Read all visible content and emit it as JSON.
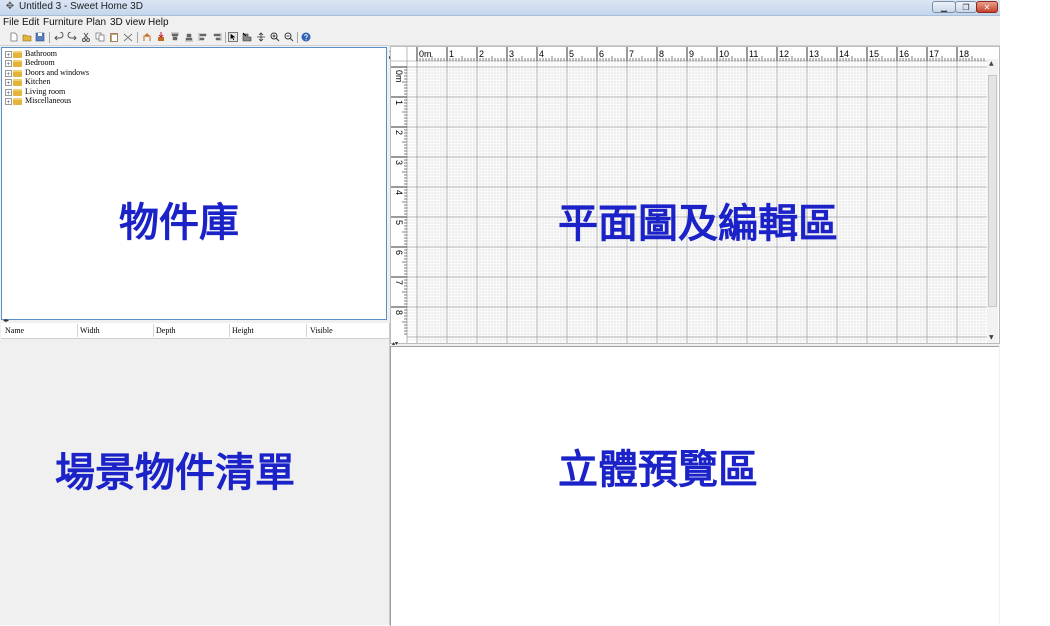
{
  "window": {
    "title": "Untitled 3 - Sweet Home 3D"
  },
  "menu": [
    "File",
    "Edit",
    "Furniture",
    "Plan",
    "3D view",
    "Help"
  ],
  "catalog": {
    "categories": [
      "Bathroom",
      "Bedroom",
      "Doors and windows",
      "Kitchen",
      "Living room",
      "Miscellaneous"
    ],
    "expand_glyph": "+",
    "annotation": "物件庫"
  },
  "furniture_list": {
    "columns": [
      "Name",
      "Width",
      "Depth",
      "Height",
      "Visible"
    ],
    "annotation": "場景物件清單"
  },
  "plan": {
    "ruler_top": [
      "0m",
      "1",
      "2",
      "3",
      "4",
      "5",
      "6",
      "7",
      "8",
      "9",
      "10",
      "11",
      "12",
      "13",
      "14",
      "15",
      "16",
      "17",
      "18"
    ],
    "ruler_left": [
      "0m",
      "1",
      "2",
      "3",
      "4",
      "5",
      "6",
      "7",
      "8"
    ],
    "annotation": "平面圖及編輯區"
  },
  "view3d": {
    "annotation": "立體預覽區"
  },
  "colors": {
    "annotation": "#1a22c8",
    "selection_border": "#5a8fc7"
  }
}
